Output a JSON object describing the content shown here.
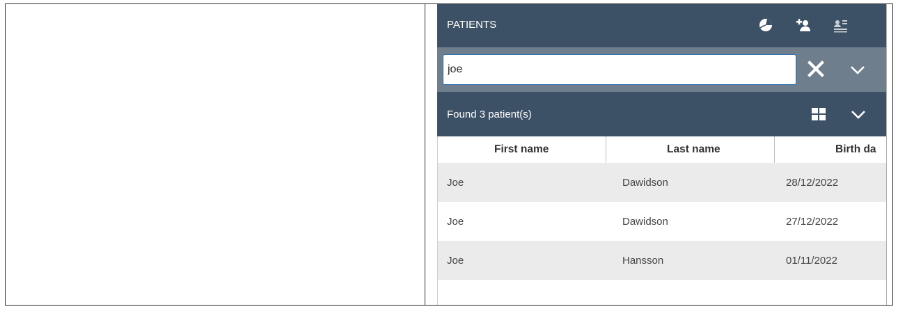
{
  "panel": {
    "title": "PATIENTS",
    "header_icons": [
      "pie-chart-icon",
      "add-user-icon",
      "patient-card-icon"
    ]
  },
  "search": {
    "value": "joe",
    "placeholder": ""
  },
  "results": {
    "summary": "Found 3 patient(s)"
  },
  "table": {
    "columns": [
      "First name",
      "Last name",
      "Birth da"
    ],
    "rows": [
      {
        "first_name": "Joe",
        "last_name": "Dawidson",
        "birth_date": "28/12/2022"
      },
      {
        "first_name": "Joe",
        "last_name": "Dawidson",
        "birth_date": "27/12/2022"
      },
      {
        "first_name": "Joe",
        "last_name": "Hansson",
        "birth_date": "01/11/2022"
      }
    ]
  },
  "colors": {
    "header_bg": "#3d5166",
    "search_bg": "#6f7e8d",
    "row_shade": "#ebebeb",
    "input_border": "#2a6fb0"
  }
}
